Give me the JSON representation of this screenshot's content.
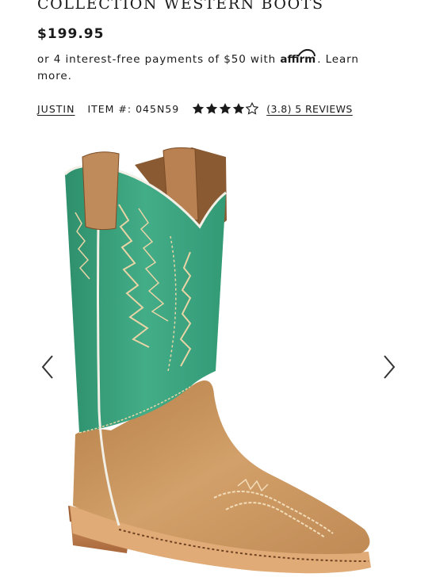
{
  "product": {
    "title": "COLLECTION WESTERN BOOTS",
    "price": "$199.95"
  },
  "financing": {
    "prefix": "or 4 interest-free payments of $50 with",
    "provider_logo_text": "affirm",
    "suffix": ".",
    "learn_more_label": "Learn more."
  },
  "meta": {
    "brand": "JUSTIN",
    "item_number": "ITEM #: 045N59",
    "rating": 3.8,
    "rating_max": 5,
    "reviews_label": "(3.8) 5 REVIEWS"
  },
  "gallery": {
    "image_alt": "boot-product-image",
    "prev_icon": "chevron-left-icon",
    "next_icon": "chevron-right-icon"
  },
  "colors": {
    "text": "#1a1a1a",
    "boot_shaft": "#3aa27e",
    "boot_leather": "#c8955e"
  }
}
